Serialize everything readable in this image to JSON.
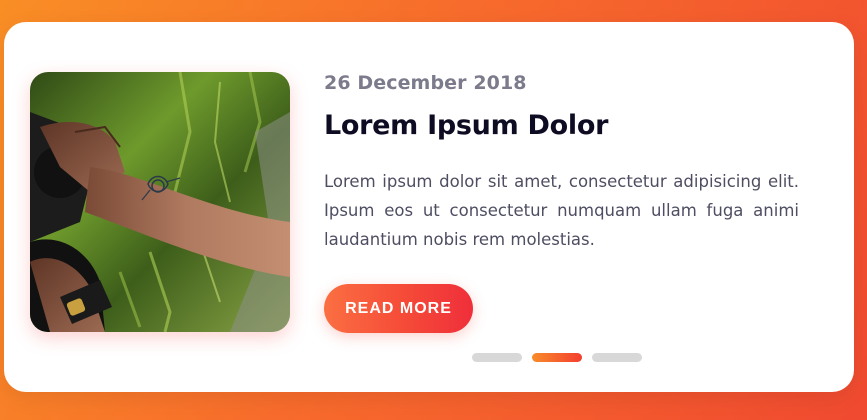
{
  "card": {
    "date": "26 December 2018",
    "title": "Lorem Ipsum Dolor",
    "text": "Lorem ipsum dolor sit amet, consectetur adipisicing elit. Ipsum eos ut consectetur numquam ullam fuga animi laudantium nobis rem molestias.",
    "read_more_label": "READ MORE",
    "image_semantic": "photo-tattooed-arm-holding-camera"
  },
  "slider": {
    "dot_count": 3,
    "active_index": 1
  },
  "colors": {
    "background_gradient_start": "#f98e25",
    "background_gradient_end": "#f04a30",
    "title": "#0d0c22",
    "date": "#7b7b8c",
    "text": "#4e4e62",
    "button_start": "#fb6f42",
    "button_end": "#ef2f3a",
    "dot_inactive": "#d8d8d8"
  }
}
